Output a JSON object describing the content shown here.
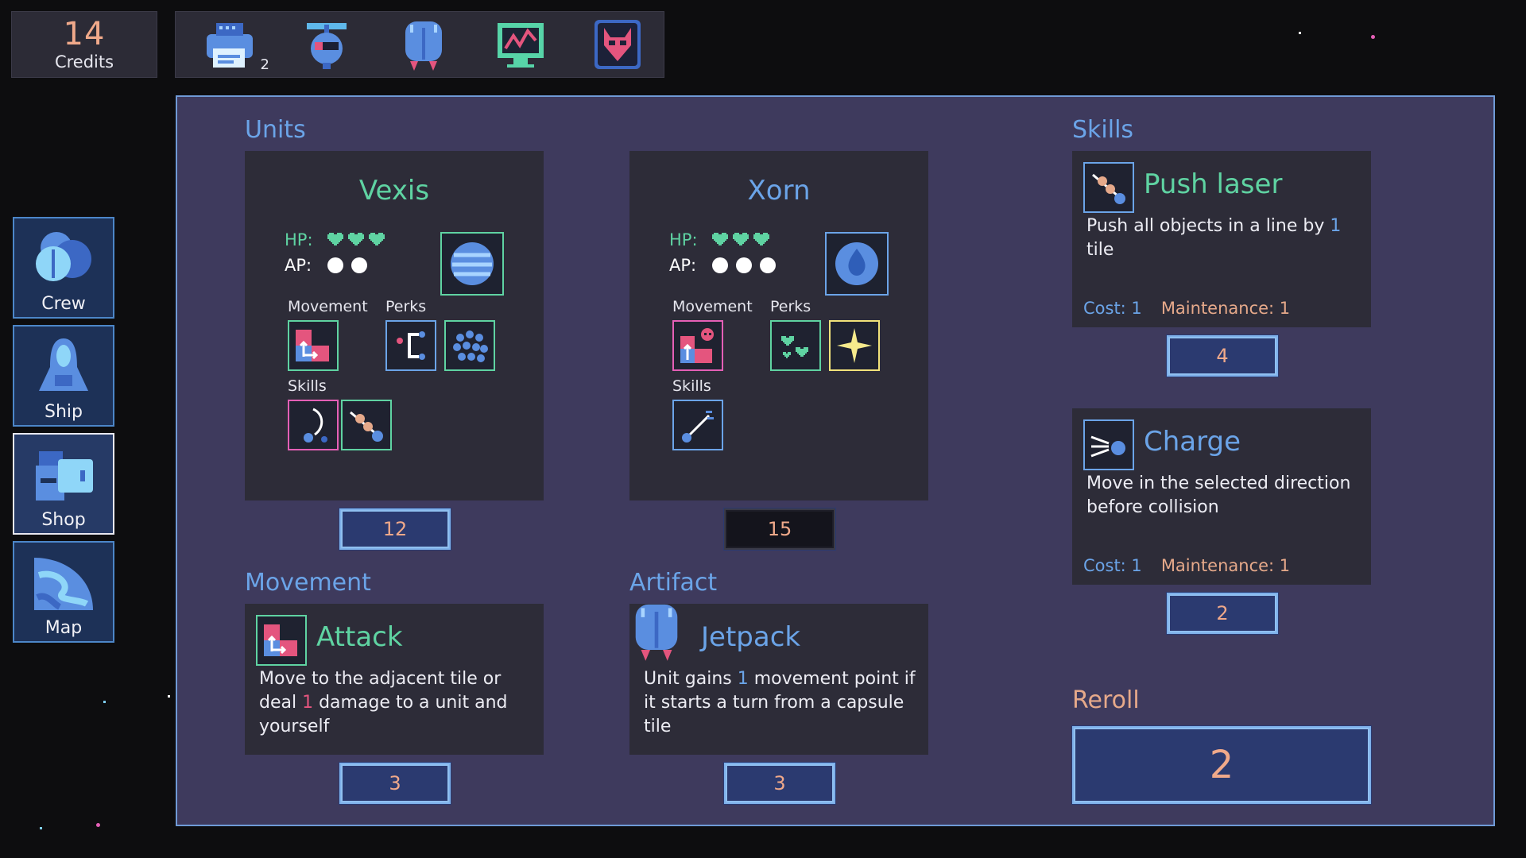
{
  "credits": {
    "value": "14",
    "label": "Credits"
  },
  "artifacts_bar": [
    {
      "icon": "printer-artifact-icon",
      "count": "2"
    },
    {
      "icon": "drone-artifact-icon",
      "count": ""
    },
    {
      "icon": "jetpack-artifact-icon",
      "count": ""
    },
    {
      "icon": "monitor-artifact-icon",
      "count": ""
    },
    {
      "icon": "demon-mask-artifact-icon",
      "count": ""
    }
  ],
  "nav": [
    {
      "label": "Crew",
      "icon": "crew-icon",
      "active": false
    },
    {
      "label": "Ship",
      "icon": "ship-icon",
      "active": false
    },
    {
      "label": "Shop",
      "icon": "shop-icon",
      "active": true
    },
    {
      "label": "Map",
      "icon": "map-icon",
      "active": false
    }
  ],
  "sections": {
    "units": "Units",
    "skills": "Skills",
    "movement": "Movement",
    "artifact": "Artifact",
    "reroll": "Reroll"
  },
  "units": [
    {
      "name": "Vexis",
      "hp_label": "HP:",
      "hp": 3,
      "ap_label": "AP:",
      "ap": 2,
      "movement_label": "Movement",
      "perks_label": "Perks",
      "skills_label": "Skills",
      "price": "12"
    },
    {
      "name": "Xorn",
      "hp_label": "HP:",
      "hp": 3,
      "ap_label": "AP:",
      "ap": 3,
      "movement_label": "Movement",
      "perks_label": "Perks",
      "skills_label": "Skills",
      "price": "15"
    }
  ],
  "skills": [
    {
      "title": "Push laser",
      "desc_pre": "Push all objects in a line by ",
      "desc_hl": "1",
      "desc_post": " tile",
      "cost_label": "Cost: 1",
      "maint_label": "Maintenance: 1",
      "price": "4"
    },
    {
      "title": "Charge",
      "desc_pre": "Move in the selected direction before collision",
      "desc_hl": "",
      "desc_post": "",
      "cost_label": "Cost: 1",
      "maint_label": "Maintenance: 1",
      "price": "2"
    }
  ],
  "movement_item": {
    "title": "Attack",
    "desc_pre": "Move to the adjacent tile or deal ",
    "desc_hl": "1",
    "desc_post": " damage to a unit and yourself",
    "price": "3"
  },
  "artifact_item": {
    "title": "Jetpack",
    "desc_pre": "Unit gains ",
    "desc_hl": "1",
    "desc_post": " movement point if it starts a turn from a capsule tile",
    "price": "3"
  },
  "reroll": {
    "price": "2"
  },
  "colors": {
    "panel": "#3e3a5d",
    "card": "#2d2c38",
    "accent_blue": "#6ba4e8",
    "accent_green": "#5fd3a2",
    "accent_orange": "#f0a98a",
    "accent_pink": "#e4557e"
  }
}
